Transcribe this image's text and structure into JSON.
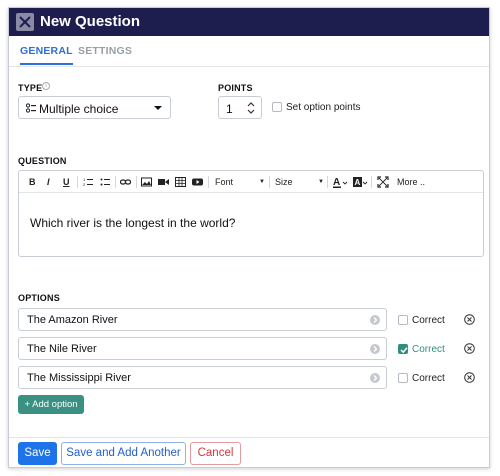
{
  "dialog": {
    "title": "New Question"
  },
  "tabs": [
    {
      "label": "GENERAL",
      "active": true
    },
    {
      "label": "SETTINGS",
      "active": false
    }
  ],
  "type_field": {
    "label": "TYPE",
    "value": "Multiple choice"
  },
  "points_field": {
    "label": "POINTS",
    "value": "1",
    "set_option_points_label": "Set option points",
    "set_option_points_checked": false
  },
  "question": {
    "label": "QUESTION",
    "toolbar": {
      "bold": "B",
      "italic": "I",
      "underline": "U",
      "font_label": "Font",
      "size_label": "Size",
      "more_label": "More .."
    },
    "text": "Which river is the longest in the world?"
  },
  "options": {
    "label": "OPTIONS",
    "correct_label": "Correct",
    "items": [
      {
        "text": "The Amazon River",
        "correct": false
      },
      {
        "text": "The Nile River",
        "correct": true
      },
      {
        "text": "The Mississippi River",
        "correct": false
      }
    ],
    "add_label": "+ Add option"
  },
  "footer": {
    "save": "Save",
    "save_another": "Save and Add Another",
    "cancel": "Cancel"
  },
  "colors": {
    "titlebar": "#1d1e4e",
    "accent": "#1f73e8",
    "correct": "#2f8f7e",
    "cancel": "#d9363e"
  }
}
